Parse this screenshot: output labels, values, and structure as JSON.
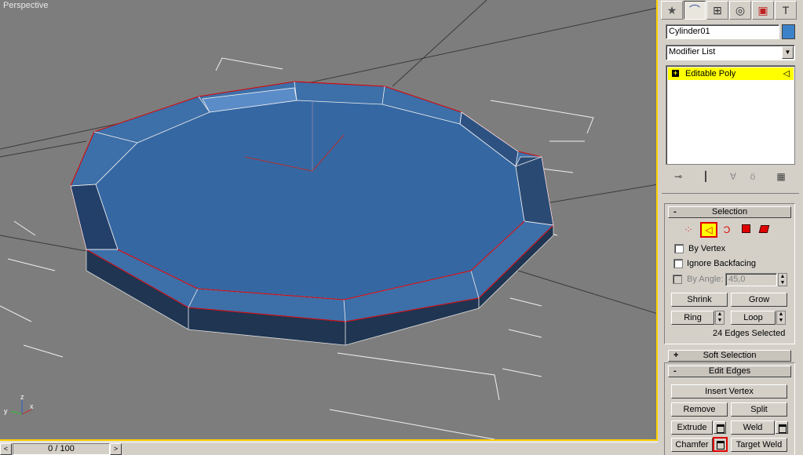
{
  "viewport": {
    "label": "Perspective",
    "axis_labels": {
      "x": "x",
      "y": "y",
      "z": "z"
    }
  },
  "timeline": {
    "prev": "<",
    "next": ">",
    "frame_readout": "0 / 100"
  },
  "command_panel": {
    "tabs": [
      "create-icon",
      "modify-icon",
      "hierarchy-icon",
      "motion-icon",
      "display-icon",
      "utilities-icon"
    ],
    "object_name": "Cylinder01",
    "object_color": "#3c82c8",
    "modifier_list": "Modifier List",
    "stack_item": "Editable Poly",
    "stack_icons": [
      "pin-icon",
      "show-end-result-icon",
      "make-unique-icon",
      "remove-modifier-icon",
      "configure-sets-icon"
    ]
  },
  "selection_rollout": {
    "title": "Selection",
    "sign": "-",
    "subobject_icons": [
      "vertex-icon",
      "edge-icon",
      "border-icon",
      "polygon-icon",
      "element-icon"
    ],
    "by_vertex": "By Vertex",
    "ignore_backfacing": "Ignore Backfacing",
    "by_angle": "By Angle:",
    "angle_value": "45,0",
    "shrink": "Shrink",
    "grow": "Grow",
    "ring": "Ring",
    "loop": "Loop",
    "status": "24 Edges Selected"
  },
  "soft_selection": {
    "title": "Soft Selection",
    "sign": "+"
  },
  "edit_edges": {
    "title": "Edit Edges",
    "sign": "-",
    "insert_vertex": "Insert Vertex",
    "remove": "Remove",
    "split": "Split",
    "extrude": "Extrude",
    "weld": "Weld",
    "chamfer": "Chamfer",
    "target_weld": "Target Weld"
  },
  "colors": {
    "viewport_bg": "#7d7d7d",
    "mesh_face": "#3d6fa8",
    "selected_edge": "#e00000",
    "active_viewport_border": "#ffd200",
    "stack_highlight": "#ffff00"
  }
}
